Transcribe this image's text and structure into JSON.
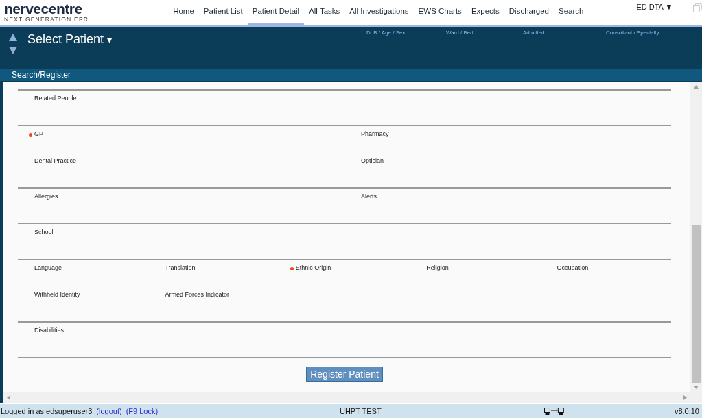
{
  "logo": {
    "name": "nervecentre",
    "tagline": "NEXT GENERATION EPR"
  },
  "nav": [
    {
      "label": "Home",
      "selected": false
    },
    {
      "label": "Patient List",
      "selected": false
    },
    {
      "label": "Patient Detail",
      "selected": true
    },
    {
      "label": "All Tasks",
      "selected": false
    },
    {
      "label": "All Investigations",
      "selected": false
    },
    {
      "label": "EWS Charts",
      "selected": false
    },
    {
      "label": "Expects",
      "selected": false
    },
    {
      "label": "Discharged",
      "selected": false
    },
    {
      "label": "Search",
      "selected": false
    }
  ],
  "location": {
    "label": "ED DTA",
    "caret": "▼"
  },
  "patient_header": {
    "title": "Select Patient",
    "caret": "▾",
    "columns": [
      "DoB / Age / Sex",
      "Ward / Bed",
      "Admitted",
      "Consultant / Specialty"
    ]
  },
  "section_bar": {
    "title": "Search/Register"
  },
  "sections": [
    {
      "kind": "two-column",
      "rows": [
        [
          {
            "label": "Related People",
            "required": false
          }
        ]
      ]
    },
    {
      "kind": "two-column",
      "rows": [
        [
          {
            "label": "GP",
            "required": true
          },
          {
            "label": "Pharmacy",
            "required": false
          }
        ],
        [
          {
            "label": "Dental Practice",
            "required": false
          },
          {
            "label": "Optician",
            "required": false
          }
        ]
      ]
    },
    {
      "kind": "two-column",
      "rows": [
        [
          {
            "label": "Allergies",
            "required": false
          },
          {
            "label": "Alerts",
            "required": false
          }
        ]
      ]
    },
    {
      "kind": "two-column",
      "rows": [
        [
          {
            "label": "School",
            "required": false
          }
        ]
      ]
    },
    {
      "kind": "five-column",
      "rows": [
        [
          {
            "label": "Language",
            "required": false
          },
          {
            "label": "Translation",
            "required": false
          },
          {
            "label": "Ethnic Origin",
            "required": true
          },
          {
            "label": "Religion",
            "required": false
          },
          {
            "label": "Occupation",
            "required": false
          }
        ],
        [
          {
            "label": "Withheld Identity",
            "required": false
          },
          {
            "label": "Armed Forces Indicator",
            "required": false
          }
        ]
      ]
    },
    {
      "kind": "two-column",
      "rows": [
        [
          {
            "label": "Disabilities",
            "required": false
          }
        ]
      ]
    }
  ],
  "register_button": "Register Patient",
  "status_bar": {
    "user_text": "Logged in as edsuperuser3",
    "logout": "(logout)",
    "lock": "(F9 Lock)",
    "environment": "UHPT TEST",
    "version": "v8.0.10"
  }
}
